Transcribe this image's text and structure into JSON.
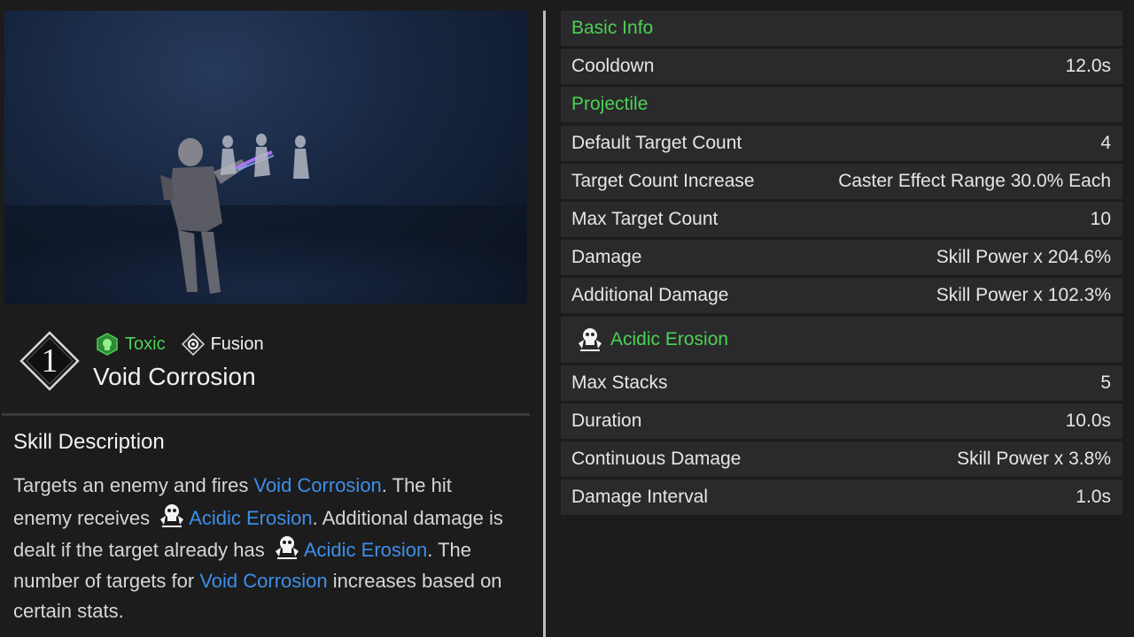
{
  "skill": {
    "slot_number": "1",
    "tags": [
      {
        "label": "Toxic",
        "icon": "toxic-icon",
        "color": "#4cd154"
      },
      {
        "label": "Fusion",
        "icon": "fusion-icon",
        "color": "#f0f0f0"
      }
    ],
    "name": "Void Corrosion"
  },
  "description": {
    "title": "Skill Description",
    "segments": {
      "s1": "Targets an enemy and fires ",
      "k1": "Void Corrosion",
      "s2": ". The hit enemy receives ",
      "k2": "Acidic Erosion",
      "s3": ". Additional damage is dealt if the target already has ",
      "k3": "Acidic Erosion",
      "s4": ". The number of targets for ",
      "k4": "Void Corrosion",
      "s5": " increases based on certain stats."
    },
    "keyword_color": "#3d8fe8"
  },
  "stats": {
    "basic_info": {
      "header": "Basic Info",
      "cooldown_label": "Cooldown",
      "cooldown_value": "12.0s"
    },
    "projectile": {
      "header": "Projectile",
      "rows": [
        {
          "label": "Default Target Count",
          "value": "4"
        },
        {
          "label": "Target Count Increase",
          "value": "Caster Effect Range 30.0% Each"
        },
        {
          "label": "Max Target Count",
          "value": "10"
        },
        {
          "label": "Damage",
          "value": "Skill Power x 204.6%"
        },
        {
          "label": "Additional Damage",
          "value": "Skill Power x 102.3%"
        }
      ]
    },
    "acidic_erosion": {
      "header": "Acidic Erosion",
      "icon": "acid-skull-icon",
      "rows": [
        {
          "label": "Max Stacks",
          "value": "5"
        },
        {
          "label": "Duration",
          "value": "10.0s"
        },
        {
          "label": "Continuous Damage",
          "value": "Skill Power x 3.8%"
        },
        {
          "label": "Damage Interval",
          "value": "1.0s"
        }
      ]
    }
  },
  "colors": {
    "accent_green": "#4cd154",
    "row_bg": "#2a2a2c",
    "page_bg": "#1c1c1d"
  }
}
